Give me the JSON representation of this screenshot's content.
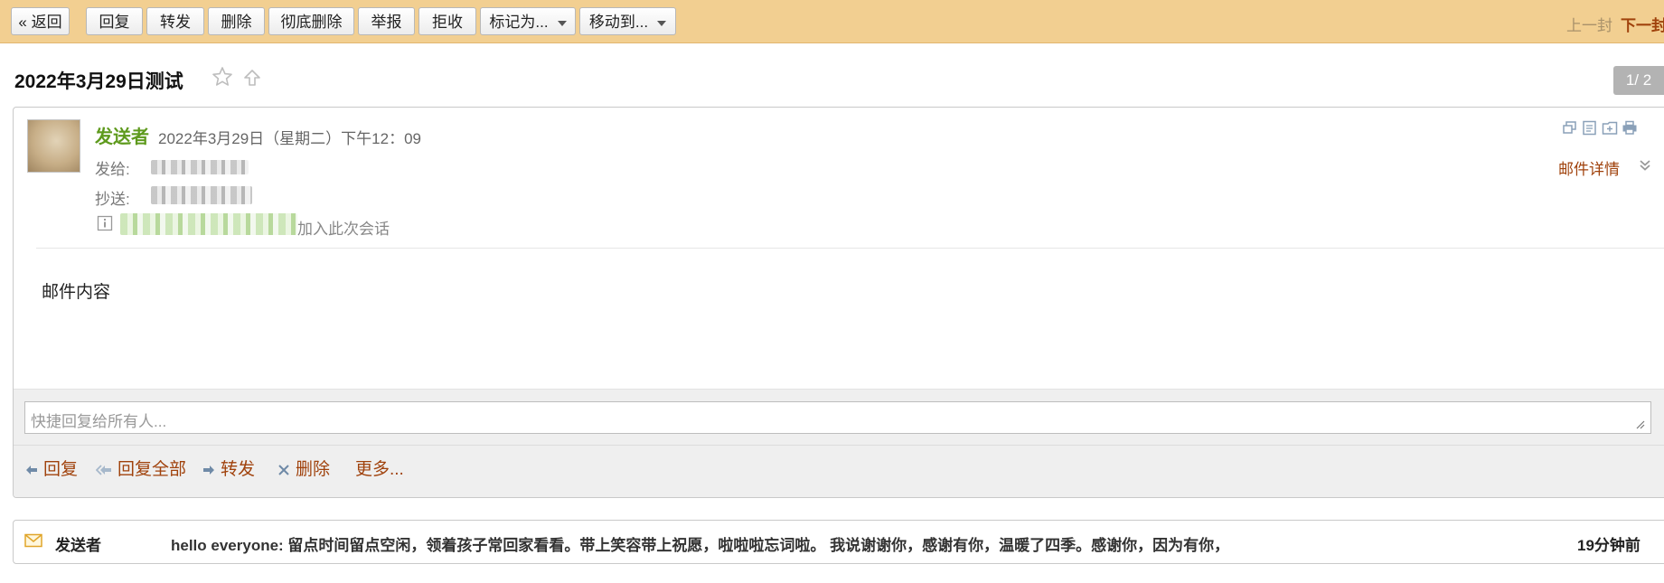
{
  "toolbar": {
    "back": "« 返回",
    "reply": "回复",
    "forward": "转发",
    "delete": "删除",
    "delete_forever": "彻底删除",
    "report": "举报",
    "reject": "拒收",
    "mark_as": "标记为...",
    "move_to": "移动到...",
    "prev": "上一封",
    "next": "下一封"
  },
  "mail": {
    "subject": "2022年3月29日测试",
    "pager": "1/ 2",
    "sender": "发送者",
    "date": "2022年3月29日（星期二）下午12：09",
    "to_label": "发给:",
    "cc_label": "抄送:",
    "join_text": "加入此次会话",
    "details_link": "邮件详情",
    "body": "邮件内容"
  },
  "quick_reply": {
    "placeholder": "快捷回复给所有人..."
  },
  "actions": {
    "reply": "回复",
    "reply_all": "回复全部",
    "forward": "转发",
    "delete": "删除",
    "more": "更多..."
  },
  "thread": {
    "sender": "发送者",
    "snippet": "hello everyone: 留点时间留点空闲，领着孩子常回家看看。带上笑容带上祝愿，啦啦啦忘词啦。 我说谢谢你，感谢有你，温暖了四季。感谢你，因为有你，",
    "time": "19分钟前"
  },
  "colors": {
    "toolbar_bg": "#f2cf91",
    "sender_green": "#5e9a1d",
    "link_brown": "#a0420c"
  }
}
